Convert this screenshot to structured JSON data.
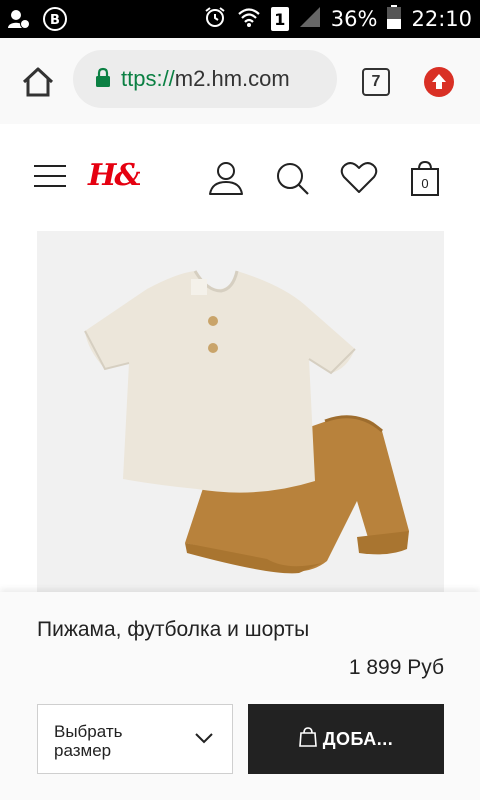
{
  "status_bar": {
    "battery": "36%",
    "time": "22:10",
    "sim": "1"
  },
  "browser": {
    "url_protocol": "ttps://",
    "url_host": "m2.hm.com",
    "tab_count": "7"
  },
  "brand": {
    "logo_text": "H&M"
  },
  "header": {
    "cart_count": "0"
  },
  "product": {
    "title": "Пижама, футболка и шорты",
    "price": "1 899 Руб",
    "size_select_label": "Выбрать размер",
    "add_button_label": "ДОБА..."
  },
  "colors": {
    "brand_red": "#e50010",
    "secure_green": "#0b8043",
    "button_dark": "#222222"
  }
}
